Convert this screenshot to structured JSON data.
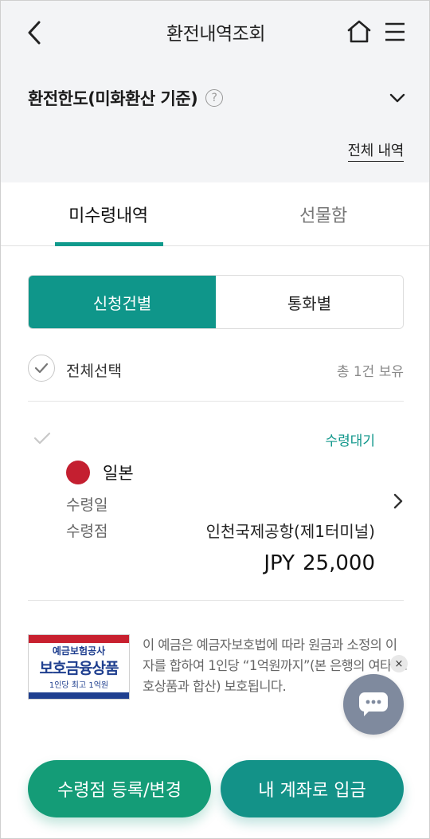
{
  "header": {
    "title": "환전내역조회",
    "back_icon": "chevron-left-icon",
    "home_icon": "home-icon",
    "menu_icon": "hamburger-menu-icon"
  },
  "limit": {
    "title": "환전한도(미화환산 기준)",
    "help_glyph": "?",
    "expand_icon": "chevron-down-icon"
  },
  "all_history_link": "전체 내역",
  "tabs": [
    {
      "label": "미수령내역",
      "active": true
    },
    {
      "label": "선물함",
      "active": false
    }
  ],
  "segment": {
    "options": [
      "신청건별",
      "통화별"
    ],
    "selected": "신청건별"
  },
  "select_all": {
    "label": "전체선택",
    "total": "총 1건 보유"
  },
  "items": [
    {
      "status": "수령대기",
      "country": "일본",
      "receive_date_label": "수령일",
      "receive_place_label": "수령점",
      "receive_place_value": "인천국제공항(제1터미널)",
      "currency": "JPY",
      "amount": "25,000"
    }
  ],
  "protection": {
    "badge_line1": "예금보험공사",
    "badge_line2": "보호금융상품",
    "badge_line3": "1인당 최고 1억원",
    "text": "이 예금은 예금자보호법에 따라 원금과 소정의 이자를 합하여 1인당 “1억원까지”(본 은행의 여타 보호상품과 합산) 보호됩니다."
  },
  "chat": {
    "close_glyph": "×",
    "icon": "chat-bubble-icon"
  },
  "buttons": {
    "left": "수령점 등록/변경",
    "right": "내 계좌로 입금"
  },
  "colors": {
    "accent": "#0f968a",
    "green_button": "#149c77",
    "teal_button": "#139288",
    "flag_red": "#c41f30",
    "header_bg": "#f3f4f6"
  }
}
